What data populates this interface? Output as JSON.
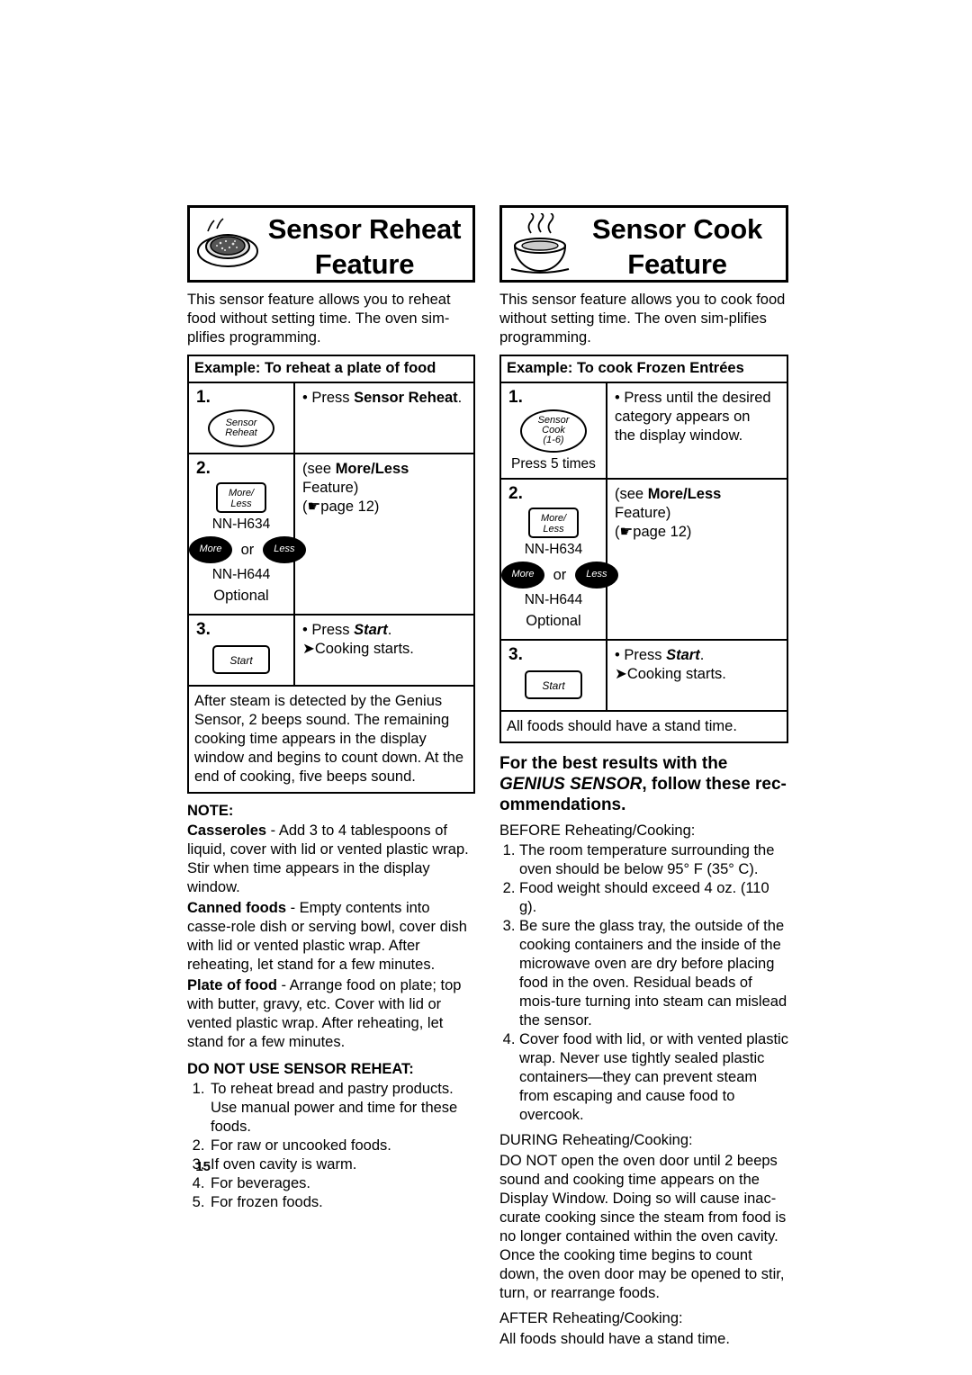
{
  "page": {
    "number": "15"
  },
  "left": {
    "banner": {
      "line1": "Sensor Reheat",
      "line2": "Feature",
      "icon": "plate-of-food-icon"
    },
    "intro": "This sensor feature allows you to reheat food without setting time. The oven sim-plifies programming.",
    "example_header": "Example: To reheat a plate of food",
    "steps": [
      {
        "num": "1.",
        "button_label_line1": "Sensor",
        "button_label_line2": "Reheat",
        "text": "• Press Sensor Reheat."
      },
      {
        "num": "2.",
        "button_label_line1": "More/",
        "button_label_line2": "Less",
        "model1": "NN-H634",
        "more_label": "More",
        "or_label": "or",
        "less_label": "Less",
        "model2": "NN-H644",
        "optional": "Optional",
        "text_line1": "(see More/Less",
        "text_line2": "Feature)",
        "text_line3": "(☛page 12)"
      },
      {
        "num": "3.",
        "button_label": "Start",
        "text_line1": "• Press Start.",
        "text_line2": "➤Cooking starts."
      }
    ],
    "after_text": "After steam is detected by the Genius Sensor, 2 beeps sound. The remaining cooking time appears in the display window and begins to count down. At the end of cooking, five beeps sound.",
    "note_title": "NOTE:",
    "notes": [
      {
        "bold": "Casseroles",
        "rest": " - Add 3 to 4 tablespoons of liquid, cover with lid or vented plastic wrap. Stir when time appears in the display window."
      },
      {
        "bold": "Canned foods",
        "rest": " - Empty contents into casse-role dish or serving bowl, cover dish with lid or vented plastic wrap. After reheating, let stand for a few minutes."
      },
      {
        "bold": "Plate of food",
        "rest": " - Arrange food on plate; top with butter, gravy, etc. Cover with lid or vented plastic wrap. After reheating, let stand for a few minutes."
      }
    ],
    "donotuse_title": "DO NOT USE SENSOR REHEAT:",
    "donotuse_items": [
      "To reheat bread and pastry products. Use manual power and time for these foods.",
      "For raw or uncooked foods.",
      "If oven cavity is warm.",
      "For beverages.",
      "For frozen foods."
    ]
  },
  "right": {
    "banner": {
      "line1": "Sensor Cook",
      "line2": "Feature",
      "icon": "steaming-bowl-icon"
    },
    "intro": "This sensor feature allows you to cook food without setting time. The oven sim-plifies programming.",
    "example_header": "Example: To cook Frozen Entrées",
    "steps": [
      {
        "num": "1.",
        "button_label_line1": "Sensor",
        "button_label_line2": "Cook",
        "button_label_line3": "(1-6)",
        "press_times": "Press 5 times",
        "text_line1": "• Press until the desired",
        "text_line2": "category appears on",
        "text_line3": "the display window."
      },
      {
        "num": "2.",
        "button_label_line1": "More/",
        "button_label_line2": "Less",
        "model1": "NN-H634",
        "more_label": "More",
        "or_label": "or",
        "less_label": "Less",
        "model2": "NN-H644",
        "optional": "Optional",
        "text_line1": "(see More/Less",
        "text_line2": "Feature)",
        "text_line3": "(☛page 12)"
      },
      {
        "num": "3.",
        "button_label": "Start",
        "text_line1": "• Press Start.",
        "text_line2": "➤Cooking starts."
      }
    ],
    "after_text": "All foods should have a stand time.",
    "rec_head_line1": "For the best results with the",
    "rec_head_ital": "GENIUS SENSOR",
    "rec_head_line2_rest": ", follow these rec-",
    "rec_head_line3": "ommendations.",
    "before_label": "BEFORE",
    "before_rest": " Reheating/Cooking:",
    "before_items": [
      "The room temperature surrounding the oven should be below 95° F (35° C).",
      "Food weight should exceed 4 oz. (110 g).",
      "Be sure the glass tray, the outside of the cooking containers and the inside of the microwave oven are dry before placing food in the oven. Residual beads of mois-ture turning into steam can mislead the sensor.",
      "Cover food with lid, or with vented plastic wrap. Never use tightly sealed plastic containers—they can prevent steam from escaping and cause food to overcook."
    ],
    "during_label": "DURING",
    "during_rest": " Reheating/Cooking:",
    "during_text": "DO NOT open the oven door until 2 beeps sound and cooking time appears on the Display Window.  Doing so will cause inac-curate cooking since the steam from food is no longer contained within the oven cavity. Once the cooking time begins to count down, the oven door may be opened to stir, turn, or rearrange foods.",
    "after_label": "AFTER",
    "after_rest": " Reheating/Cooking:"
  }
}
